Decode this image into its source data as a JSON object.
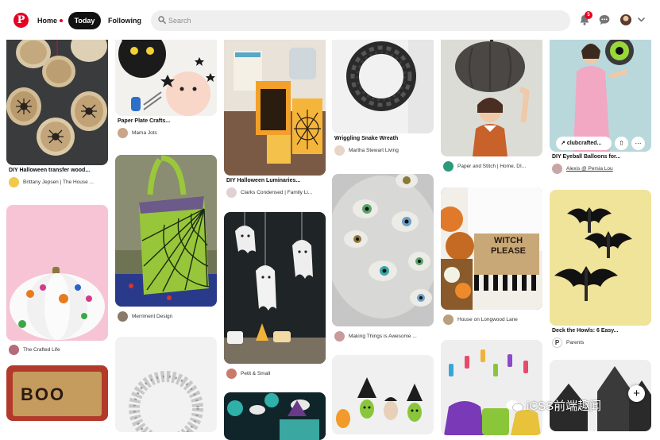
{
  "header": {
    "logo": "P",
    "nav_home": "Home",
    "nav_today": "Today",
    "nav_following": "Following",
    "search_placeholder": "Search",
    "notification_count": "5"
  },
  "columns": [
    [
      {
        "title": "DIY Halloween transfer wood...",
        "source": "Brittany Jepsen | The House ..."
      },
      {
        "title": "",
        "source": "The Crafted Life"
      },
      {
        "title": "",
        "source": ""
      }
    ],
    [
      {
        "title": "Paper Plate Crafts...",
        "source": "Mama Jots"
      },
      {
        "title": "",
        "source": "Merriment Design"
      },
      {
        "title": "",
        "source": ""
      }
    ],
    [
      {
        "title": "DIY Halloween Luminaries...",
        "source": "Clarks Condensed | Family Li..."
      },
      {
        "title": "",
        "source": "Petit & Small"
      },
      {
        "title": "",
        "source": ""
      }
    ],
    [
      {
        "title": "Wriggling Snake Wreath",
        "source": "Martha Stewart Living"
      },
      {
        "title": "",
        "source": "Making Things is Awesome ..."
      },
      {
        "title": "",
        "source": ""
      }
    ],
    [
      {
        "title": "",
        "source": "Paper and Stitch | Home, DI..."
      },
      {
        "title": "",
        "source": "House on Longwood Lane"
      },
      {
        "title": "",
        "source": ""
      }
    ],
    [
      {
        "title": "DIY Eyeball Balloons for...",
        "source": "Alexis @ Persia Lou",
        "overlay_link": "clubcrafted..."
      },
      {
        "title": "Deck the Howls: 6 Easy...",
        "source": "Parents"
      },
      {
        "title": "",
        "source": ""
      }
    ]
  ],
  "image_texts": {
    "witch_please": "WITCH PLEASE",
    "boo": "BOO"
  },
  "add_button": "+",
  "watermark": "iCSS前端趣闻",
  "colors": {
    "brand": "#e60023",
    "active_tab": "#111111"
  }
}
